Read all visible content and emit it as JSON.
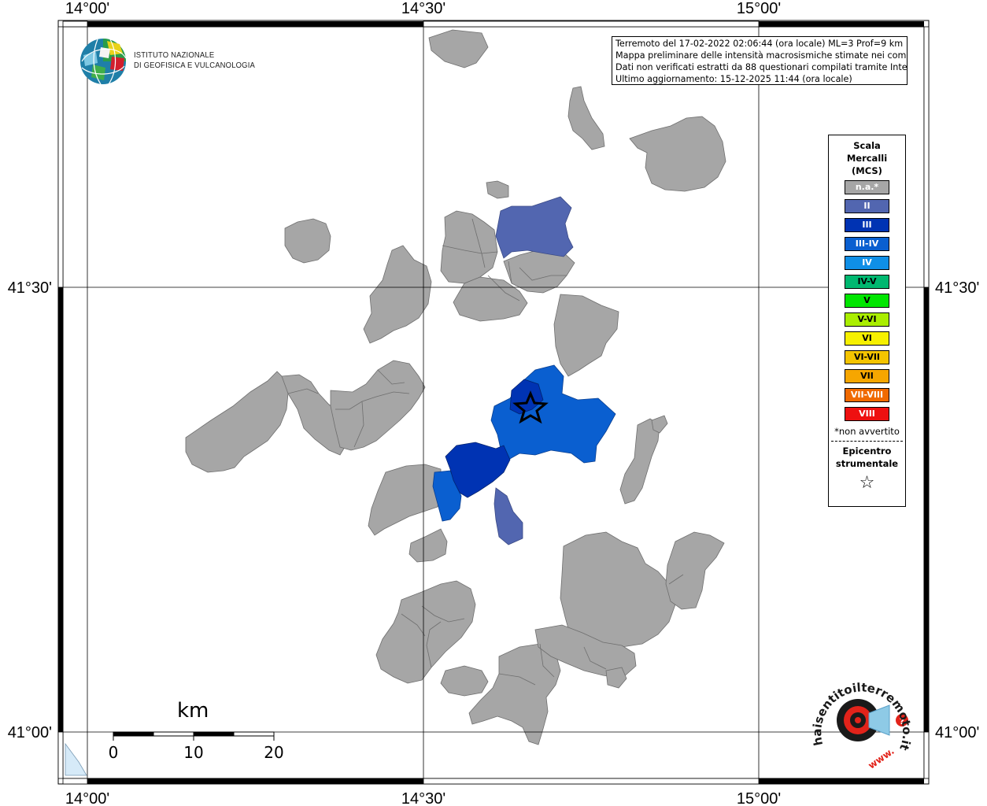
{
  "map_frame": {
    "top_labels": [
      "14°00'",
      "14°30'",
      "15°00'"
    ],
    "bottom_labels": [
      "14°00'",
      "14°30'",
      "15°00'"
    ],
    "left_labels": [
      "41°30'",
      "41°00'"
    ],
    "right_labels": [
      "41°30'",
      "41°00'"
    ]
  },
  "info_box": {
    "lines": [
      "Terremoto del 17-02-2022 02:06:44 (ora locale) ML=3 Prof=9 km",
      "Mappa preliminare delle intensità macrosismiche stimate nei comuni",
      "Dati non verificati estratti da 88 questionari compilati tramite Internet.",
      "Ultimo aggiornamento: 15-12-2025 11:44 (ora locale)"
    ]
  },
  "ingv_logo": {
    "line1": "ISTITUTO NAZIONALE",
    "line2": "DI GEOFISICA E VULCANOLOGIA"
  },
  "legend": {
    "title_1": "Scala",
    "title_2": "Mercalli",
    "title_3": "(MCS)",
    "items": [
      {
        "label": "n.a.*",
        "color": "#a6a6a6"
      },
      {
        "label": "II",
        "color": "#5266b0"
      },
      {
        "label": "III",
        "color": "#0033b3"
      },
      {
        "label": "III-IV",
        "color": "#0a5fd0"
      },
      {
        "label": "IV",
        "color": "#0f8fe6"
      },
      {
        "label": "IV-V",
        "color": "#00b870"
      },
      {
        "label": "V",
        "color": "#00e600"
      },
      {
        "label": "V-VI",
        "color": "#aaee00"
      },
      {
        "label": "VI",
        "color": "#f6f000"
      },
      {
        "label": "VI-VII",
        "color": "#f4c400"
      },
      {
        "label": "VII",
        "color": "#f6a600"
      },
      {
        "label": "VII-VIII",
        "color": "#f06a00"
      },
      {
        "label": "VIII",
        "color": "#ee1010"
      }
    ],
    "note": "*non avvertito",
    "epicenter_1": "Epicentro",
    "epicenter_2": "strumentale",
    "epicenter_symbol": "☆"
  },
  "scale_bar": {
    "unit": "km",
    "labels": [
      "0",
      "10",
      "20"
    ]
  },
  "hai_sentito_logo": {
    "text": "haisentitoilterremoto.it",
    "url_text": "www."
  },
  "colors": {
    "not_available": "#a6a6a6",
    "intensity_II": "#5266b0",
    "intensity_III": "#0033b3",
    "intensity_III_IV": "#0a5fd0",
    "sea": "#d6eaf8"
  }
}
